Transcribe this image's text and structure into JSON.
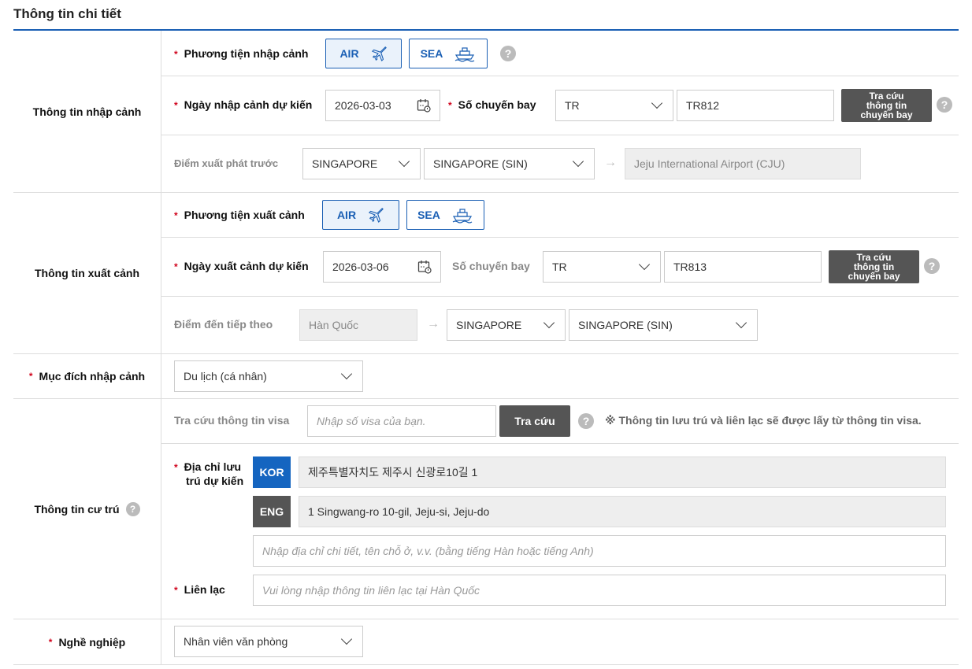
{
  "title": "Thông tin chi tiết",
  "entry": {
    "section_label": "Thông tin nhập cảnh",
    "transport_label": "Phương tiện nhập cảnh",
    "air": "AIR",
    "sea": "SEA",
    "date_label": "Ngày nhập cảnh dự kiến",
    "date_value": "2026-03-03",
    "flight_label": "Số chuyến bay",
    "airline_value": "TR",
    "flight_value": "TR812",
    "lookup_button": "Tra cứu thông tin chuyến bay",
    "origin_label": "Điểm xuất phát trước",
    "origin_country": "SINGAPORE",
    "origin_airport": "SINGAPORE (SIN)",
    "destination_airport": "Jeju International Airport (CJU)"
  },
  "exit": {
    "section_label": "Thông tin xuất cảnh",
    "transport_label": "Phương tiện xuất cảnh",
    "air": "AIR",
    "sea": "SEA",
    "date_label": "Ngày xuất cảnh dự kiến",
    "date_value": "2026-03-06",
    "flight_label": "Số chuyến bay",
    "airline_value": "TR",
    "flight_value": "TR813",
    "lookup_button": "Tra cứu thông tin chuyến bay",
    "next_label": "Điểm đến tiếp theo",
    "from_country": "Hàn Quốc",
    "next_country": "SINGAPORE",
    "next_airport": "SINGAPORE (SIN)"
  },
  "purpose": {
    "label": "Mục đích nhập cảnh",
    "value": "Du lịch (cá nhân)"
  },
  "residence": {
    "section_label": "Thông tin cư trú",
    "visa_label": "Tra cứu thông tin visa",
    "visa_placeholder": "Nhập số visa của bạn.",
    "visa_button": "Tra cứu",
    "visa_note": "※ Thông tin lưu trú và liên lạc sẽ được lấy từ thông tin visa.",
    "address_label": "Địa chỉ lưu trú dự kiến",
    "kor_tag": "KOR",
    "kor_address": "제주특별자치도 제주시 신광로10길 1",
    "eng_tag": "ENG",
    "eng_address": "1 Singwang-ro 10-gil, Jeju-si, Jeju-do",
    "detail_placeholder": "Nhập địa chỉ chi tiết, tên chỗ ở, v.v. (bằng tiếng Hàn hoặc tiếng Anh)",
    "contact_label": "Liên lạc",
    "contact_placeholder": "Vui lòng nhập thông tin liên lạc tại Hàn Quốc"
  },
  "occupation": {
    "label": "Nghề nghiệp",
    "value": "Nhân viên văn phòng"
  },
  "colors": {
    "accent": "#1a5fb4",
    "required": "#d0021b",
    "kor_tag": "#1565c0",
    "eng_tag": "#555555"
  },
  "icons": [
    "plane-icon",
    "ship-icon",
    "calendar-icon",
    "help-icon",
    "chevron-down-icon",
    "arrow-right-icon"
  ]
}
